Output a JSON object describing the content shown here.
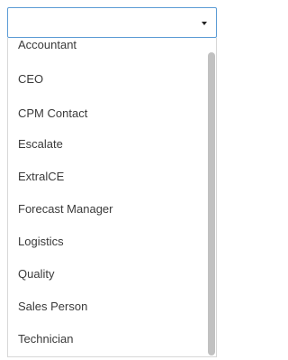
{
  "select": {
    "value": "",
    "icon": "chevron-down-icon"
  },
  "options": [
    "Accountant",
    "CEO",
    "CPM Contact",
    "Escalate",
    "ExtralCE",
    "Forecast Manager",
    "Logistics",
    "Quality",
    "Sales Person",
    "Technician"
  ]
}
